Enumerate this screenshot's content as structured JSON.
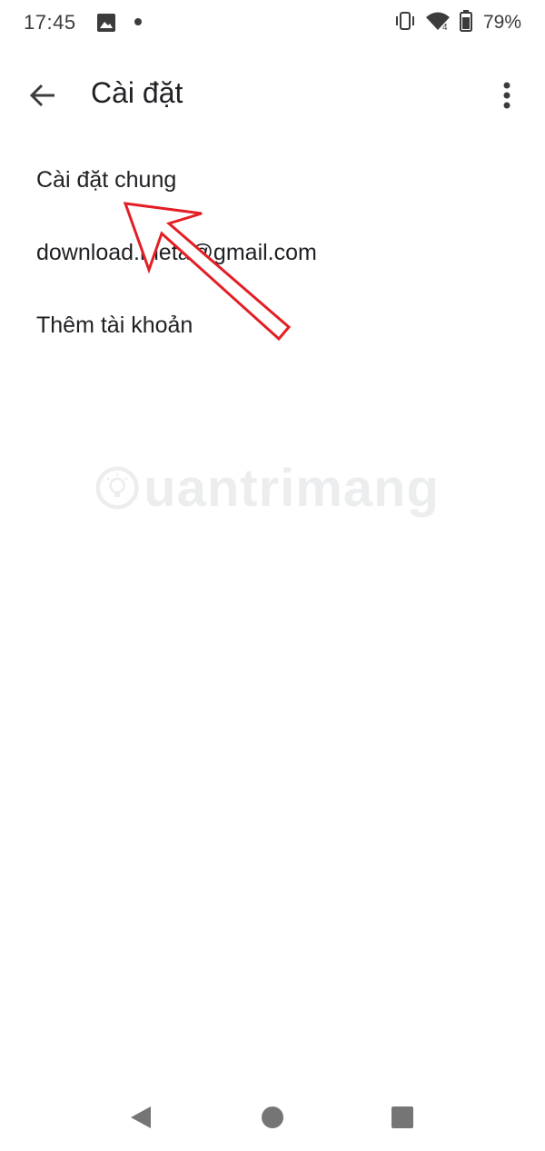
{
  "status_bar": {
    "time": "17:45",
    "battery_percent": "79%",
    "icons": [
      "image-icon",
      "notification-dot-icon",
      "vibrate-icon",
      "wifi-icon",
      "battery-icon"
    ]
  },
  "app_bar": {
    "title": "Cài đặt",
    "back_icon": "arrow-back-icon",
    "more_icon": "more-vert-icon"
  },
  "settings": {
    "items": [
      {
        "label": "Cài đặt chung"
      },
      {
        "label": "download.meta@gmail.com"
      },
      {
        "label": "Thêm tài khoản"
      }
    ]
  },
  "watermark": {
    "text": "uantrimang"
  },
  "colors": {
    "annotation_arrow": "#e31e24",
    "text_primary": "#202124",
    "icon_gray": "#5f6368",
    "nav_gray": "#757575"
  },
  "nav_bar": {
    "icons": [
      "nav-back-icon",
      "nav-home-icon",
      "nav-recents-icon"
    ]
  }
}
